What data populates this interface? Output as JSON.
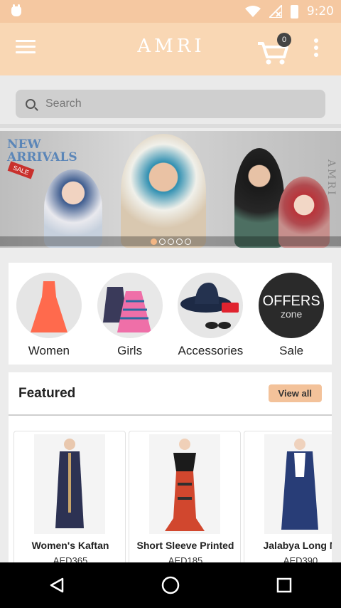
{
  "status_bar": {
    "time": "9:20",
    "icons": [
      "app-indicator-icon",
      "wifi-icon",
      "no-signal-icon",
      "battery-icon"
    ]
  },
  "app_bar": {
    "brand": "AMRI",
    "cart_count": "0",
    "icons": [
      "menu-icon",
      "cart-icon",
      "overflow-icon"
    ]
  },
  "search": {
    "placeholder": "Search"
  },
  "banner": {
    "headline_line1": "NEW",
    "headline_line2": "ARRIVALS",
    "tag": "SALE",
    "side_brand": "AMRI",
    "slide_count": 5,
    "active_slide": 1
  },
  "categories": [
    {
      "label": "Women"
    },
    {
      "label": "Girls"
    },
    {
      "label": "Accessories"
    },
    {
      "label": "Sale",
      "badge_line1": "OFFERS",
      "badge_line2": "zone"
    }
  ],
  "featured": {
    "title": "Featured",
    "view_all_label": "View all",
    "products": [
      {
        "name": "Women's Kaftan",
        "price": "AED365"
      },
      {
        "name": "Short Sleeve Printed",
        "price": "AED185"
      },
      {
        "name": "Jalabya Long M",
        "price": "AED390"
      }
    ]
  },
  "colors": {
    "status_bar": "#f5c8a1",
    "app_bar": "#f9d7b4",
    "accent_button": "#f3c29a"
  }
}
